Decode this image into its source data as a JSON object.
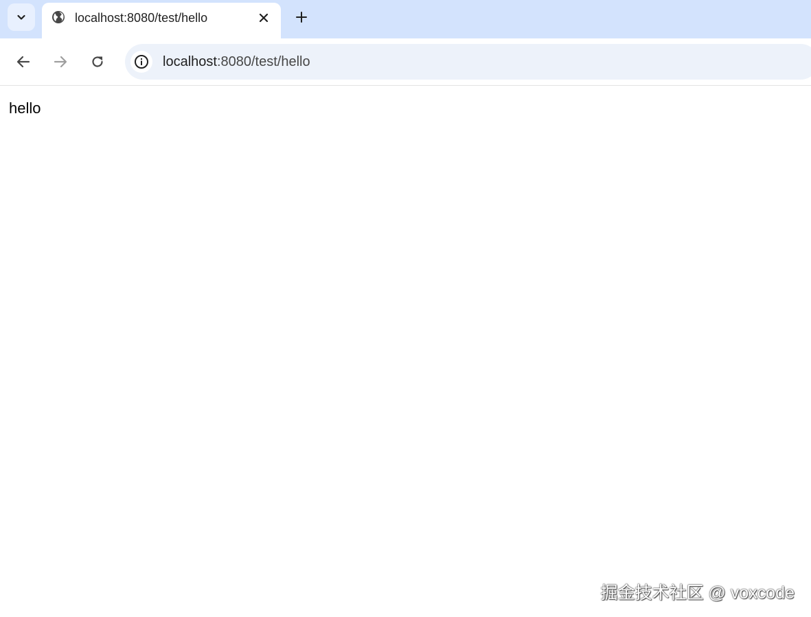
{
  "tab": {
    "title": "localhost:8080/test/hello",
    "favicon": "globe-icon"
  },
  "toolbar": {
    "back_icon": "arrow-left-icon",
    "forward_icon": "arrow-right-icon",
    "reload_icon": "reload-icon",
    "site_info_icon": "info-icon"
  },
  "address_bar": {
    "host": "localhost",
    "rest": ":8080/test/hello"
  },
  "page": {
    "body_text": "hello"
  },
  "watermark": {
    "text": "掘金技术社区 @ voxcode"
  },
  "colors": {
    "tabstrip_bg": "#d3e3fd",
    "omnibox_bg": "#edf2fa",
    "icon_color": "#474747",
    "disabled_icon_color": "#9e9e9e"
  }
}
